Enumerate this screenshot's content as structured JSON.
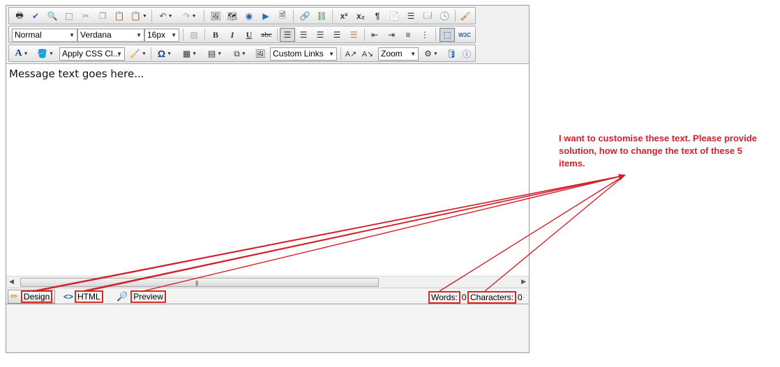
{
  "toolbar": {
    "row2": {
      "paragraph_format": "Normal",
      "font_name": "Verdana",
      "font_size": "16px"
    },
    "row3": {
      "apply_css_class": "Apply CSS Cl...",
      "custom_links": "Custom Links",
      "zoom": "Zoom"
    },
    "labels": {
      "bold": "B",
      "italic": "I",
      "underline": "U",
      "strike": "abc",
      "font_color": "A",
      "special_chars": "Ω",
      "superscript": "x²",
      "subscript": "x₂",
      "paragraph": "¶"
    }
  },
  "editor": {
    "message_text": "Message text goes here..."
  },
  "modes": {
    "design": "Design",
    "html": "HTML",
    "preview": "Preview"
  },
  "status": {
    "words_label": "Words:",
    "words_value": "0",
    "characters_label": "Characters:",
    "characters_value": "0"
  },
  "annotation": {
    "text": "I want to customise these text. Please provide solution, how to change the text of these 5 items."
  },
  "colors": {
    "annotation": "#d21f2a",
    "toolbar_bg": "#f0f0f0"
  }
}
